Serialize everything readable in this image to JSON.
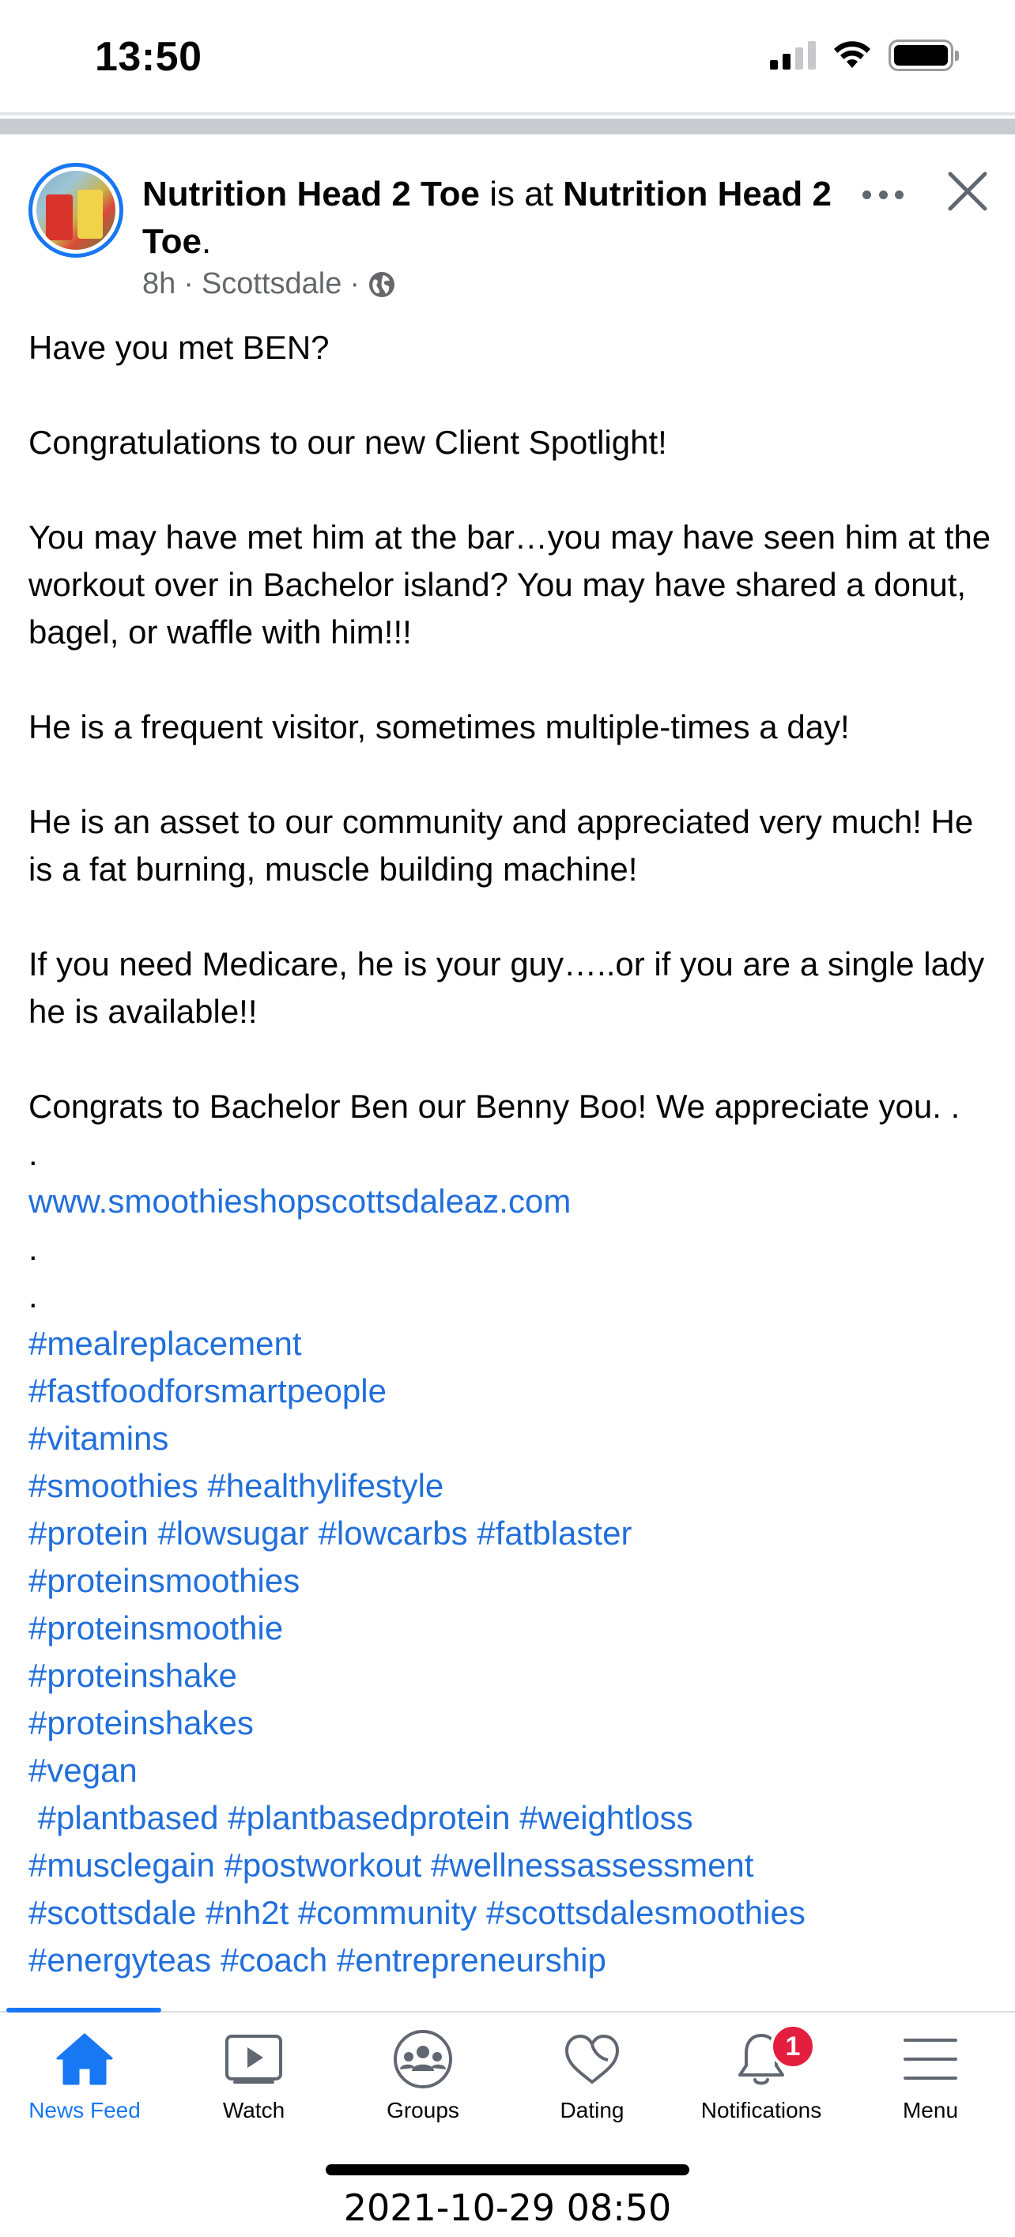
{
  "status_bar": {
    "time": "13:50"
  },
  "post": {
    "author": "Nutrition Head 2 Toe",
    "is_at_text": " is at ",
    "place": "Nutrition Head 2 Toe",
    "place_suffix": ".",
    "time_ago": "8h",
    "location": "Scottsdale",
    "separator": "·",
    "privacy_icon": "globe-icon",
    "paragraphs": [
      "Have you met BEN?",
      "Congratulations to our new Client Spotlight!",
      "You may have met him at the bar…you may have seen him at the workout over in Bachelor island? You may have shared a donut, bagel, or waffle with him!!!",
      "He is a frequent visitor, sometimes multiple-times a day!",
      "He is an asset to our community and appreciated very much!  He is a fat burning, muscle building machine!",
      "If you need Medicare, he is your guy…..or if you are a single lady he is available!!",
      "Congrats to Bachelor Ben our Benny Boo! We appreciate you. ."
    ],
    "dot_1": ".",
    "link": "www.smoothieshopscottsdaleaz.com",
    "dot_2": ".",
    "dot_3": ".",
    "hashtag_lines": [
      "#mealreplacement",
      "#fastfoodforsmartpeople",
      "#vitamins",
      "#smoothies #healthylifestyle",
      "#protein #lowsugar #lowcarbs #fatblaster",
      "#proteinsmoothies",
      "#proteinsmoothie",
      "#proteinshake",
      "#proteinshakes",
      "#vegan",
      " #plantbased #plantbasedprotein #weightloss",
      "#musclegain #postworkout #wellnessassessment",
      "#scottsdale #nh2t #community #scottsdalesmoothies",
      "#energyteas #coach #entrepreneurship"
    ]
  },
  "tab_bar": {
    "tabs": [
      {
        "label": "News Feed",
        "icon": "home-icon",
        "active": true
      },
      {
        "label": "Watch",
        "icon": "watch-icon",
        "active": false
      },
      {
        "label": "Groups",
        "icon": "groups-icon",
        "active": false
      },
      {
        "label": "Dating",
        "icon": "heart-icon",
        "active": false
      },
      {
        "label": "Notifications",
        "icon": "bell-icon",
        "active": false,
        "badge": "1"
      },
      {
        "label": "Menu",
        "icon": "menu-icon",
        "active": false
      }
    ]
  },
  "timestamp_overlay": "2021-10-29 08:50",
  "colors": {
    "accent": "#1877f2",
    "link": "#216fdb",
    "badge": "#e41e3f",
    "meta": "#65676b"
  }
}
